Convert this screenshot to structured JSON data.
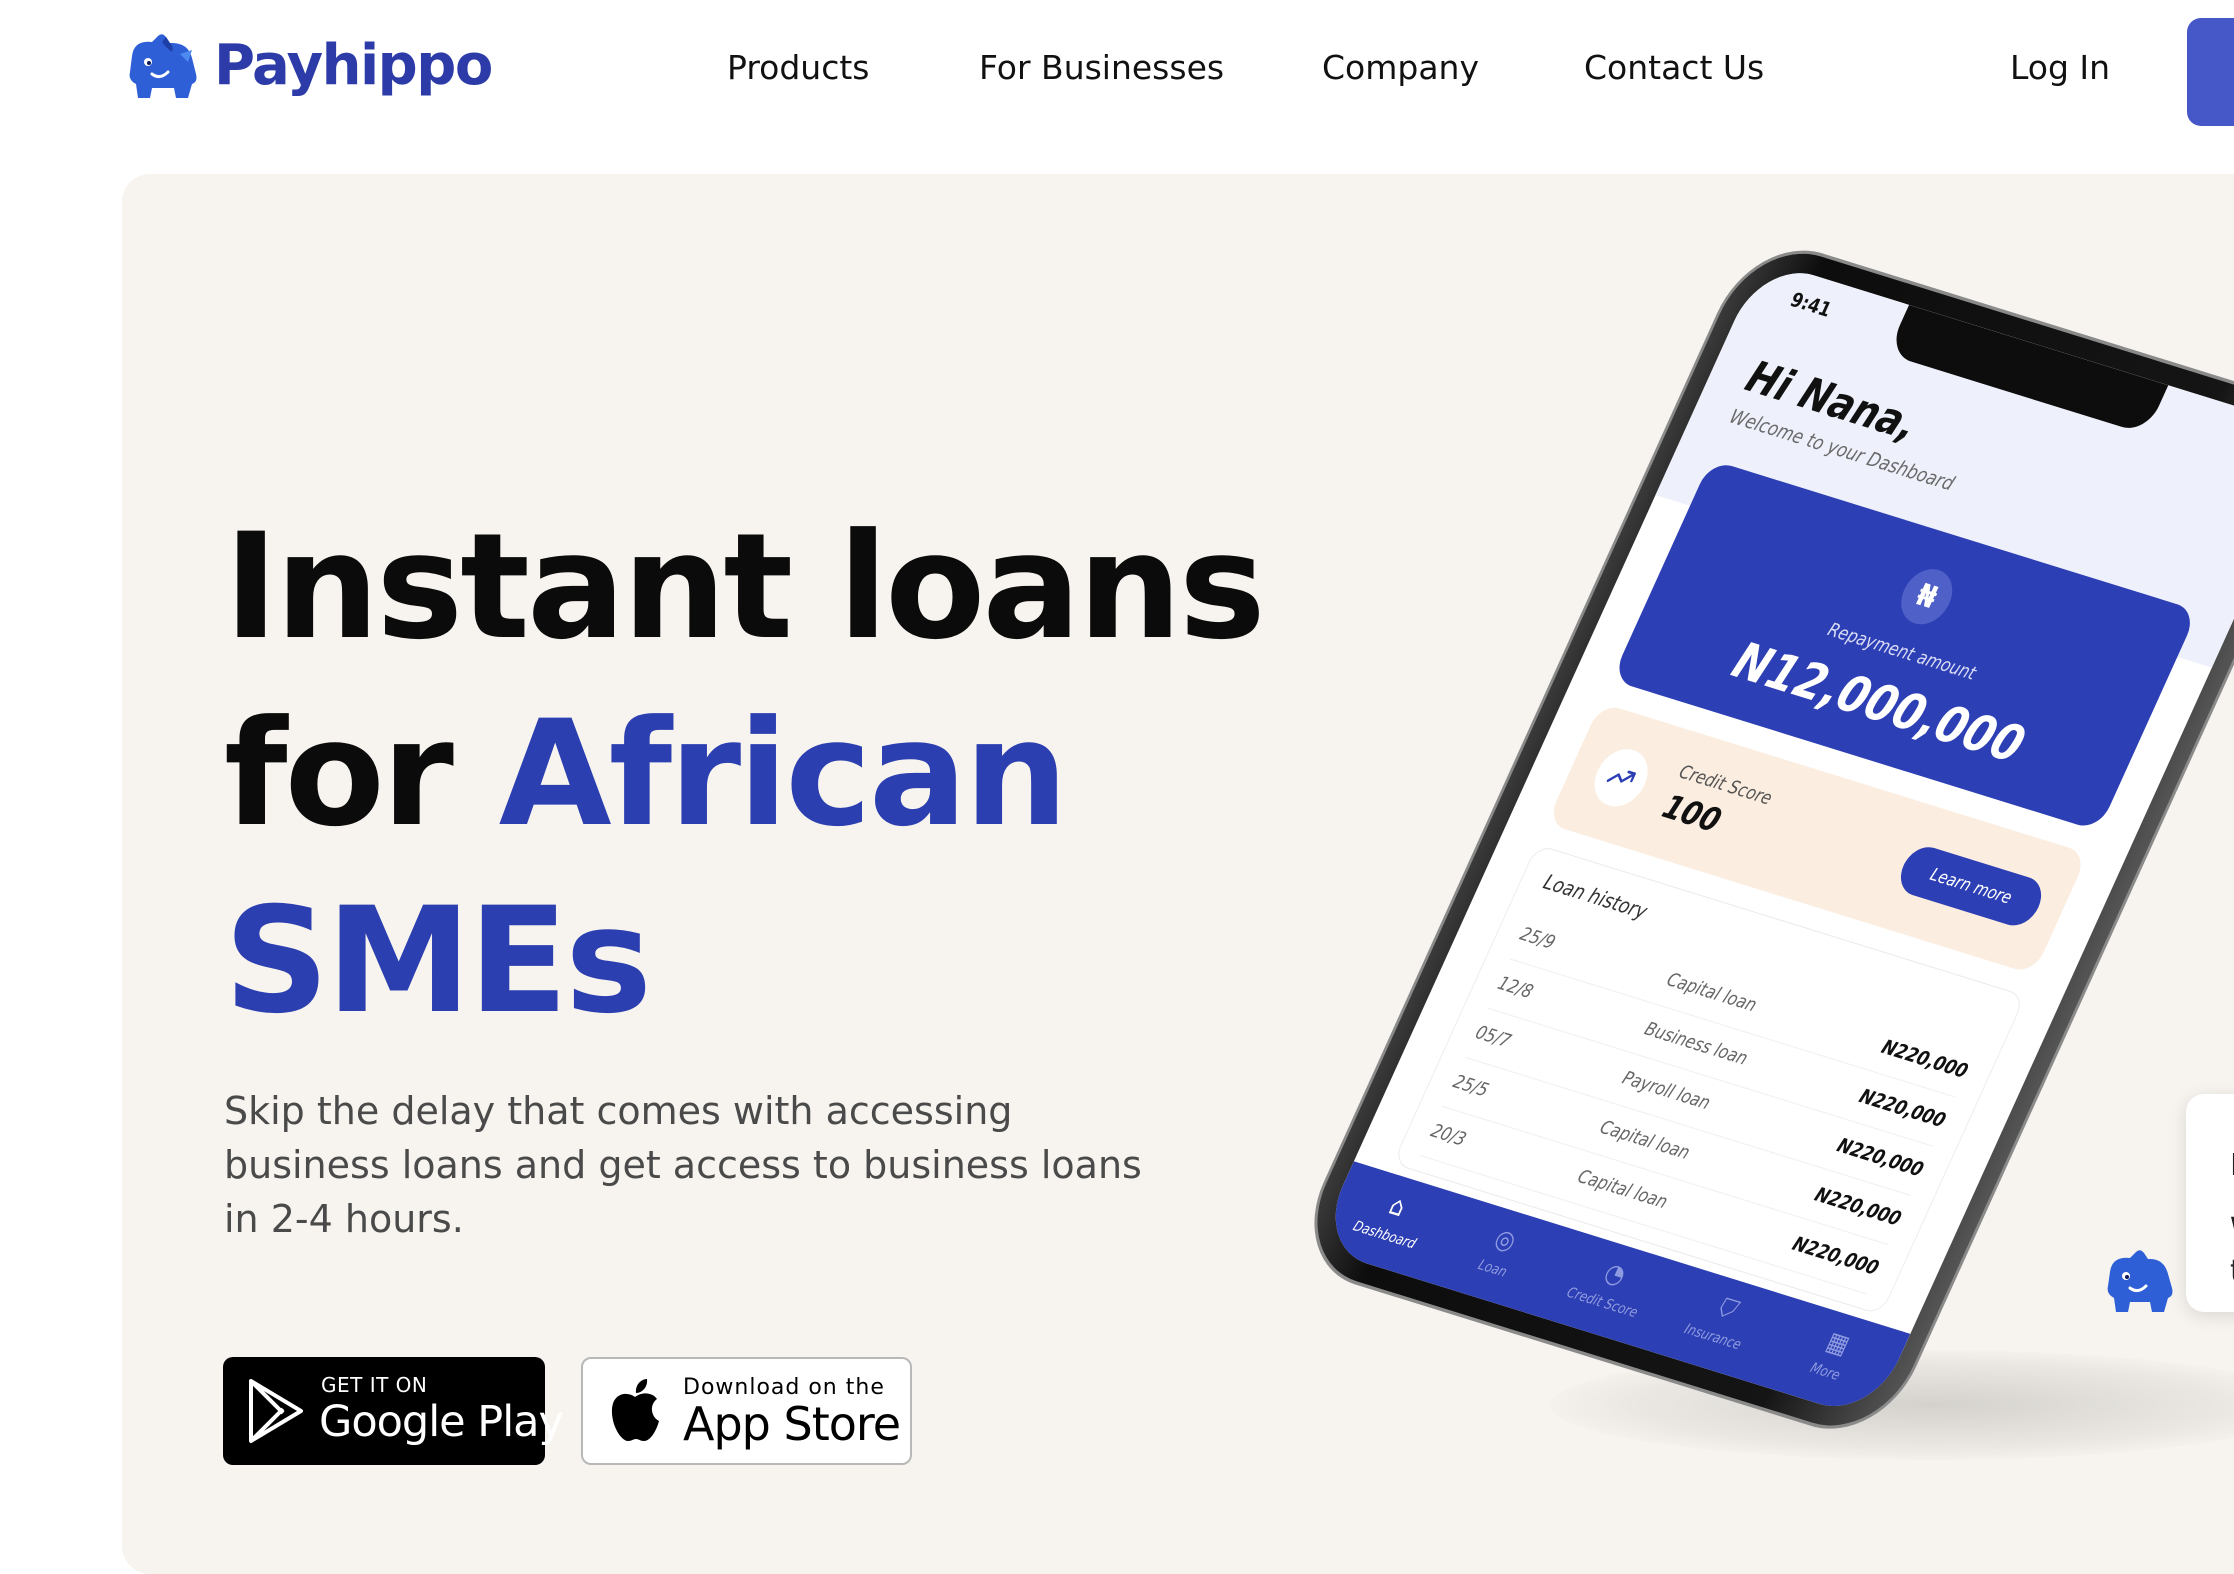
{
  "brand": {
    "name": "Payhippo",
    "color": "#2c3ba8",
    "accent": "#2c3fb0"
  },
  "nav": {
    "links": [
      "Products",
      "For Businesses",
      "Company",
      "Contact Us"
    ],
    "login": "Log In"
  },
  "hero": {
    "headline_line1": "Instant loans",
    "headline_for": "for ",
    "headline_african": "African",
    "headline_smes": "SMEs",
    "subtitle": "Skip the delay that comes with accessing business loans and get access to business loans in 2-4 hours."
  },
  "badges": {
    "google_small": "GET IT ON",
    "google_big": "Google Play",
    "apple_small": "Download on the",
    "apple_big": "App Store"
  },
  "phone": {
    "time": "9:41",
    "greeting": "Hi Nana,",
    "welcome": "Welcome to your Dashboard",
    "naira_symbol": "₦",
    "repayment_label": "Repayment amount",
    "repayment_amount": "N12,000,000",
    "credit_label": "Credit Score",
    "credit_value": "100",
    "learn_more": "Learn more",
    "history_title": "Loan history",
    "history": [
      {
        "date": "25/9",
        "type": "Capital loan",
        "amount": "N220,000"
      },
      {
        "date": "12/8",
        "type": "Business loan",
        "amount": "N220,000"
      },
      {
        "date": "05/7",
        "type": "Payroll loan",
        "amount": "N220,000"
      },
      {
        "date": "25/5",
        "type": "Capital loan",
        "amount": "N220,000"
      },
      {
        "date": "20/3",
        "type": "Capital loan",
        "amount": "N220,000"
      }
    ],
    "tabs": [
      {
        "label": "Dashboard",
        "icon": "home-icon"
      },
      {
        "label": "Loan",
        "icon": "loan-icon"
      },
      {
        "label": "Credit Score",
        "icon": "gauge-icon"
      },
      {
        "label": "Insurance",
        "icon": "shield-icon"
      },
      {
        "label": "More",
        "icon": "grid-icon"
      }
    ]
  },
  "chat_card": {
    "line1": "F",
    "line2": "W",
    "line3": "t"
  }
}
